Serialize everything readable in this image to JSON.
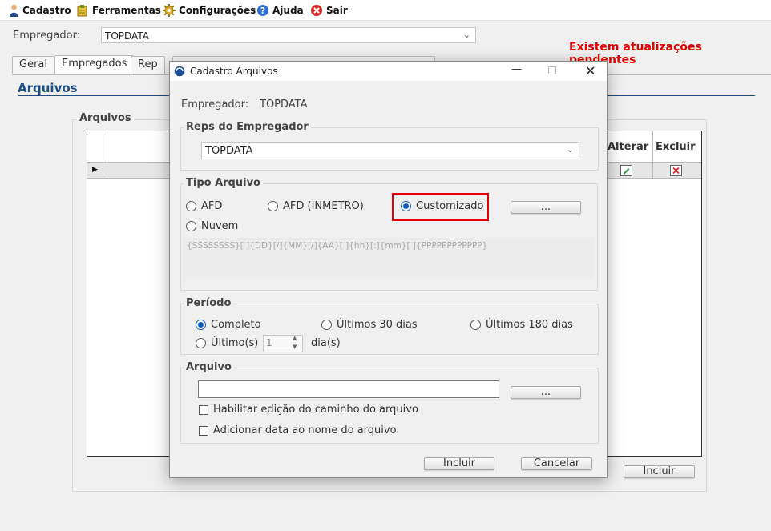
{
  "menu": {
    "items": [
      {
        "label": "Cadastro",
        "icon": "user-icon"
      },
      {
        "label": "Ferramentas",
        "icon": "tools-icon"
      },
      {
        "label": "Configurações",
        "icon": "gear-icon"
      },
      {
        "label": "Ajuda",
        "icon": "help-icon"
      },
      {
        "label": "Sair",
        "icon": "exit-icon"
      }
    ]
  },
  "main": {
    "employer_label": "Empregador:",
    "employer_value": "TOPDATA",
    "alert": "Existem atualizações pendentes",
    "alert_color": "#e00000",
    "tabs": [
      "Geral",
      "Empregados",
      "Rep"
    ],
    "section_title": "Arquivos",
    "group_title": "Arquivos",
    "grid_headers": {
      "alterar": "Alterar",
      "excluir": "Excluir"
    },
    "incluir_button": "Incluir"
  },
  "dialog": {
    "title": "Cadastro Arquivos",
    "employer_label": "Empregador:",
    "employer_value": "TOPDATA",
    "reps_group": "Reps do Empregador",
    "reps_value": "TOPDATA",
    "tipo_group": "Tipo Arquivo",
    "tipo_options": {
      "afd": "AFD",
      "afd_inmetro": "AFD (INMETRO)",
      "customizado": "Customizado",
      "nuvem": "Nuvem"
    },
    "tipo_selected": "Customizado",
    "dots_button": "...",
    "pattern": "{SSSSSSSS}[ ]{DD}[/]{MM}[/]{AA}[ ]{hh}[:]{mm}[ ]{PPPPPPPPPPPP}",
    "periodo_group": "Período",
    "periodo_options": {
      "completo": "Completo",
      "ult30": "Últimos 30 dias",
      "ult180": "Últimos 180 dias",
      "ultimos": "Último(s)",
      "dias": "dia(s)"
    },
    "periodo_selected": "Completo",
    "ultimos_value": "1",
    "arquivo_group": "Arquivo",
    "arquivo_value": "",
    "check_habilitar": "Habilitar edição do caminho do arquivo",
    "check_adicionar": "Adicionar data ao nome do arquivo",
    "incluir_button": "Incluir",
    "cancelar_button": "Cancelar",
    "highlight_color": "#e00000"
  }
}
